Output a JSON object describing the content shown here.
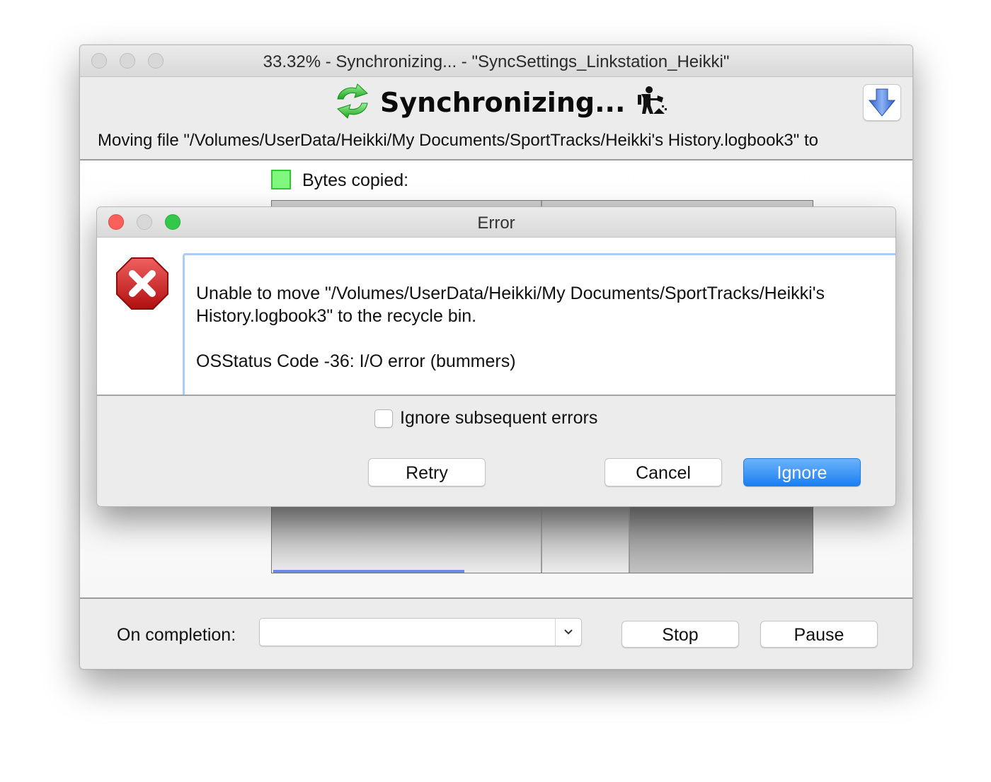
{
  "main_window": {
    "title": "33.32% - Synchronizing... - \"SyncSettings_Linkstation_Heikki\"",
    "heading": "Synchronizing...",
    "status_line": "Moving file \"/Volumes/UserData/Heikki/My Documents/SportTracks/Heikki's History.logbook3\" to",
    "icons": {
      "sync": "sync-arrows-icon",
      "worker": "digging-worker-icon",
      "download": "down-arrow-icon"
    },
    "graph": {
      "legend_label": "Bytes copied:",
      "legend_color": "#80f880",
      "progress_color": "#6a88e8",
      "progress_fraction": 0.3332
    },
    "footer": {
      "on_completion_label": "On completion:",
      "on_completion_value": "",
      "stop_label": "Stop",
      "pause_label": "Pause"
    }
  },
  "error_dialog": {
    "title": "Error",
    "icon": "error-stop-icon",
    "message_line1": "Unable to move \"/Volumes/UserData/Heikki/My Documents/SportTracks/Heikki's History.logbook3\" to the recycle bin.",
    "message_line2": "OSStatus Code -36: I/O error (bummers)",
    "checkbox_label": "Ignore subsequent errors",
    "checkbox_checked": false,
    "buttons": {
      "retry": "Retry",
      "cancel": "Cancel",
      "ignore": "Ignore"
    },
    "accent_color": "#1b7ff2"
  }
}
